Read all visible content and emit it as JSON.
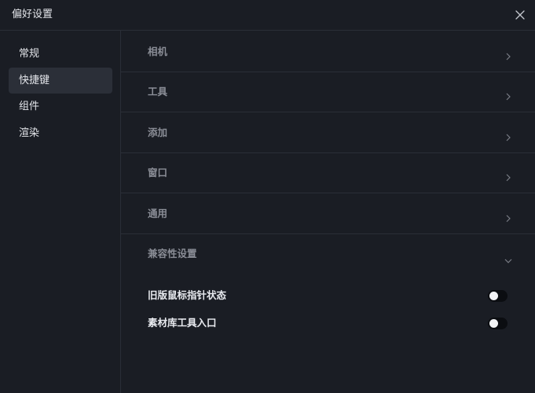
{
  "window": {
    "title": "偏好设置"
  },
  "sidebar": {
    "items": [
      {
        "label": "常规",
        "active": false
      },
      {
        "label": "快捷键",
        "active": true
      },
      {
        "label": "组件",
        "active": false
      },
      {
        "label": "渲染",
        "active": false
      }
    ]
  },
  "content": {
    "sections": [
      {
        "label": "相机",
        "expanded": false
      },
      {
        "label": "工具",
        "expanded": false
      },
      {
        "label": "添加",
        "expanded": false
      },
      {
        "label": "窗口",
        "expanded": false
      },
      {
        "label": "通用",
        "expanded": false
      },
      {
        "label": "兼容性设置",
        "expanded": true
      }
    ],
    "compat_settings": [
      {
        "label": "旧版鼠标指针状态",
        "enabled": false
      },
      {
        "label": "素材库工具入口",
        "enabled": false
      }
    ]
  },
  "icons": {
    "close": "close-icon",
    "collapsed": "chevron-right-icon",
    "expanded": "chevron-down-icon"
  },
  "colors": {
    "background": "#1a1d24",
    "active_item": "#2b2f38",
    "divider": "#2a2e37",
    "toggle_off": "#0b0d11"
  }
}
